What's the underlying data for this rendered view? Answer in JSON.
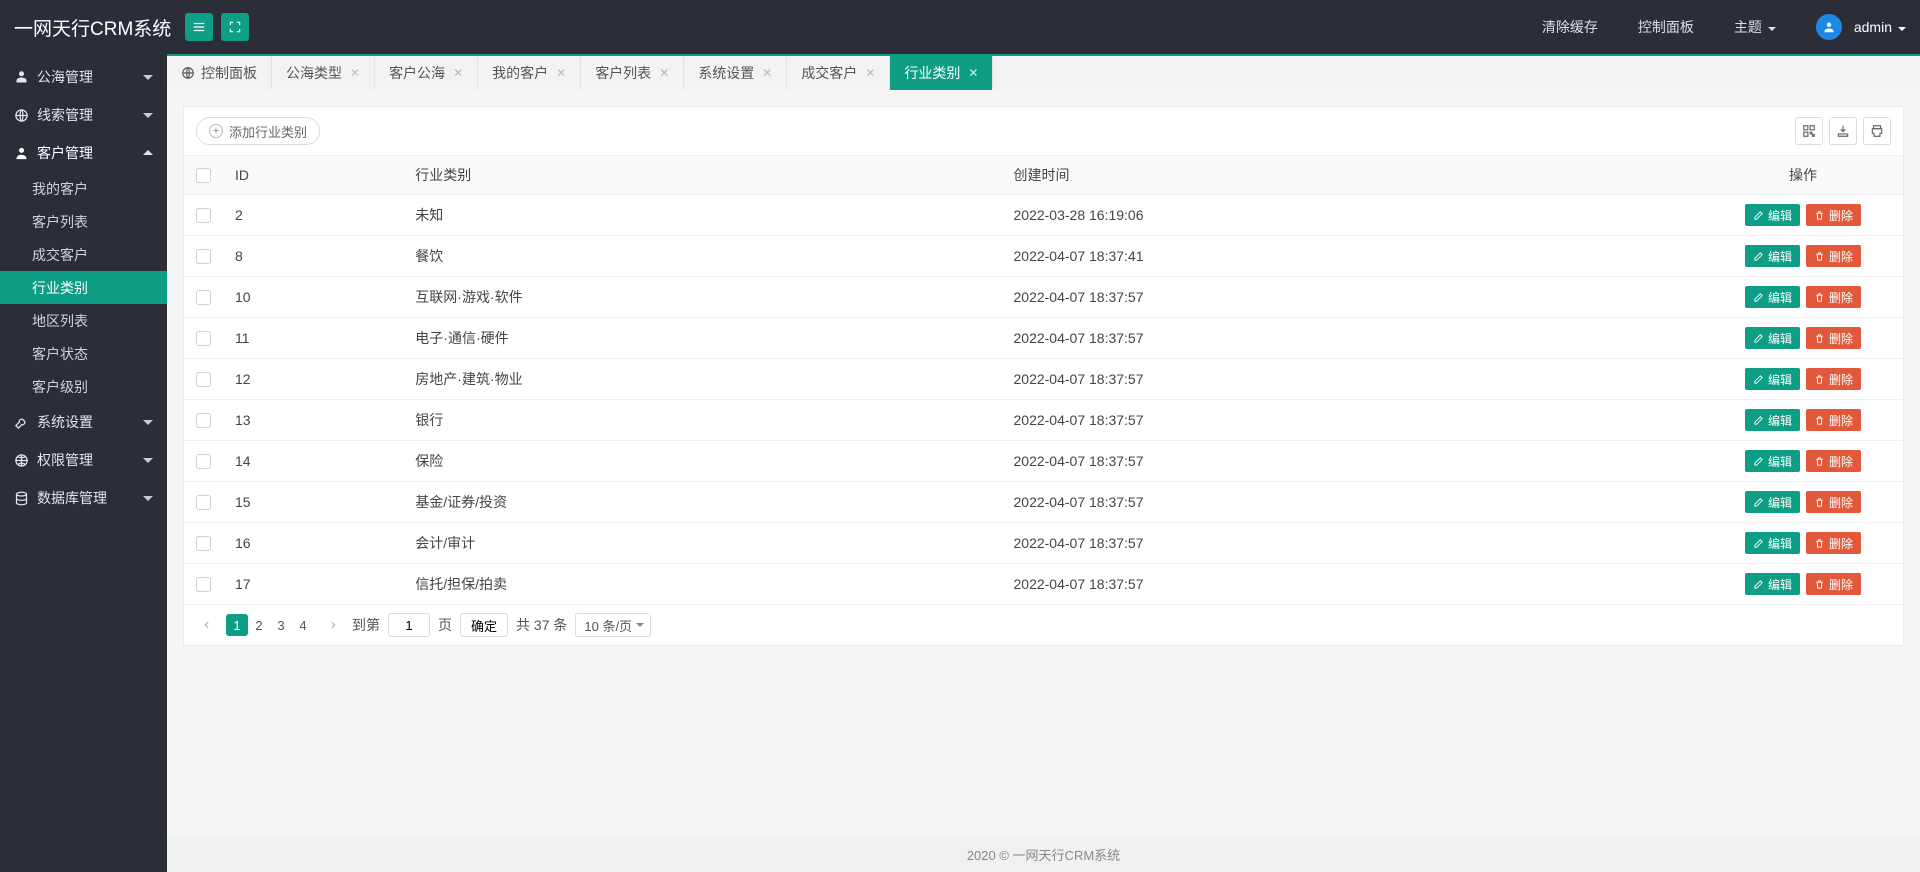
{
  "header": {
    "logo": "一网天行CRM系统",
    "clear_cache": "清除缓存",
    "control_panel": "控制面板",
    "theme": "主题",
    "user": "admin"
  },
  "sidebar": [
    {
      "label": "公海管理",
      "icon": "pool",
      "open": false,
      "items": []
    },
    {
      "label": "线索管理",
      "icon": "globe",
      "open": false,
      "items": []
    },
    {
      "label": "客户管理",
      "icon": "user",
      "open": true,
      "items": [
        {
          "label": "我的客户",
          "active": false
        },
        {
          "label": "客户列表",
          "active": false
        },
        {
          "label": "成交客户",
          "active": false
        },
        {
          "label": "行业类别",
          "active": true
        },
        {
          "label": "地区列表",
          "active": false
        },
        {
          "label": "客户状态",
          "active": false
        },
        {
          "label": "客户级别",
          "active": false
        }
      ]
    },
    {
      "label": "系统设置",
      "icon": "wrench",
      "open": false,
      "items": []
    },
    {
      "label": "权限管理",
      "icon": "globe2",
      "open": false,
      "items": []
    },
    {
      "label": "数据库管理",
      "icon": "database",
      "open": false,
      "items": []
    }
  ],
  "tabs": [
    {
      "label": "控制面板",
      "home": true,
      "closable": false,
      "active": false
    },
    {
      "label": "公海类型",
      "home": false,
      "closable": true,
      "active": false
    },
    {
      "label": "客户公海",
      "home": false,
      "closable": true,
      "active": false
    },
    {
      "label": "我的客户",
      "home": false,
      "closable": true,
      "active": false
    },
    {
      "label": "客户列表",
      "home": false,
      "closable": true,
      "active": false
    },
    {
      "label": "系统设置",
      "home": false,
      "closable": true,
      "active": false
    },
    {
      "label": "成交客户",
      "home": false,
      "closable": true,
      "active": false
    },
    {
      "label": "行业类别",
      "home": false,
      "closable": true,
      "active": true
    }
  ],
  "toolbar": {
    "add_label": "添加行业类别"
  },
  "table": {
    "columns": {
      "id": "ID",
      "category": "行业类别",
      "created": "创建时间",
      "op": "操作"
    },
    "buttons": {
      "edit": "编辑",
      "delete": "删除"
    },
    "rows": [
      {
        "id": "2",
        "category": "未知",
        "created": "2022-03-28 16:19:06"
      },
      {
        "id": "8",
        "category": "餐饮",
        "created": "2022-04-07 18:37:41"
      },
      {
        "id": "10",
        "category": "互联网·游戏·软件",
        "created": "2022-04-07 18:37:57"
      },
      {
        "id": "11",
        "category": "电子·通信·硬件",
        "created": "2022-04-07 18:37:57"
      },
      {
        "id": "12",
        "category": "房地产·建筑·物业",
        "created": "2022-04-07 18:37:57"
      },
      {
        "id": "13",
        "category": "银行",
        "created": "2022-04-07 18:37:57"
      },
      {
        "id": "14",
        "category": "保险",
        "created": "2022-04-07 18:37:57"
      },
      {
        "id": "15",
        "category": "基金/证券/投资",
        "created": "2022-04-07 18:37:57"
      },
      {
        "id": "16",
        "category": "会计/审计",
        "created": "2022-04-07 18:37:57"
      },
      {
        "id": "17",
        "category": "信托/担保/拍卖",
        "created": "2022-04-07 18:37:57"
      }
    ]
  },
  "pager": {
    "pages": [
      "1",
      "2",
      "3",
      "4"
    ],
    "current": "1",
    "goto_prefix": "到第",
    "goto_value": "1",
    "goto_suffix": "页",
    "confirm": "确定",
    "total": "共 37 条",
    "page_size": "10 条/页"
  },
  "footer": "2020 ©   一网天行CRM系统"
}
